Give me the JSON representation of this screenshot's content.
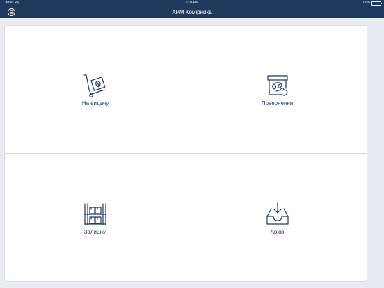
{
  "status_bar": {
    "carrier": "Carrier",
    "time": "6:03 PM",
    "battery": "100%",
    "icons": [
      "wifi-icon",
      "battery-icon"
    ]
  },
  "nav": {
    "title": "АРМ Комірника",
    "menu_icon": "menu-icon"
  },
  "colors": {
    "navbar": "#1f3a5c",
    "icon": "#1f3a5c",
    "background": "#e9ecf0",
    "card": "#ffffff",
    "divider": "#d7dbe1"
  },
  "tiles": [
    {
      "label": "На видачу",
      "icon": "hand-truck-box-icon"
    },
    {
      "label": "Повернення",
      "icon": "return-box-icon"
    },
    {
      "label": "Залишки",
      "icon": "shelving-stock-icon"
    },
    {
      "label": "Архів",
      "icon": "archive-inbox-icon"
    }
  ]
}
